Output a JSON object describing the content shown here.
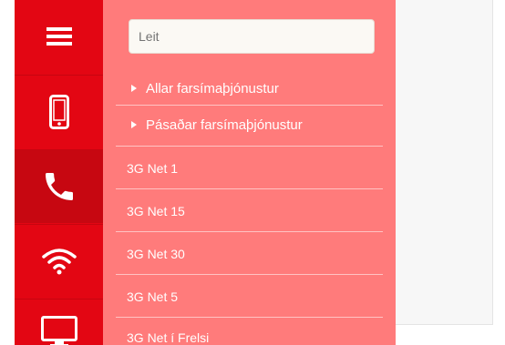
{
  "rail": {
    "items": [
      {
        "name": "menu",
        "icon": "hamburger-menu-icon"
      },
      {
        "name": "mobile",
        "icon": "mobile-phone-icon"
      },
      {
        "name": "phone",
        "icon": "phone-handset-icon",
        "active": true
      },
      {
        "name": "internet",
        "icon": "wifi-icon"
      },
      {
        "name": "tv",
        "icon": "tv-monitor-icon"
      }
    ]
  },
  "search": {
    "placeholder": "Leit"
  },
  "menu": {
    "groups": [
      "Allar farsímaþjónustur",
      "Pásaðar farsímaþjónustur"
    ],
    "items": [
      "3G Net 1",
      "3G Net 15",
      "3G Net 30",
      "3G Net 5",
      "3G Net í Frelsi"
    ]
  },
  "colors": {
    "rail": "#e30613",
    "rail_active": "#c70711",
    "panel": "#ff7b7b",
    "text": "#ffffff"
  }
}
